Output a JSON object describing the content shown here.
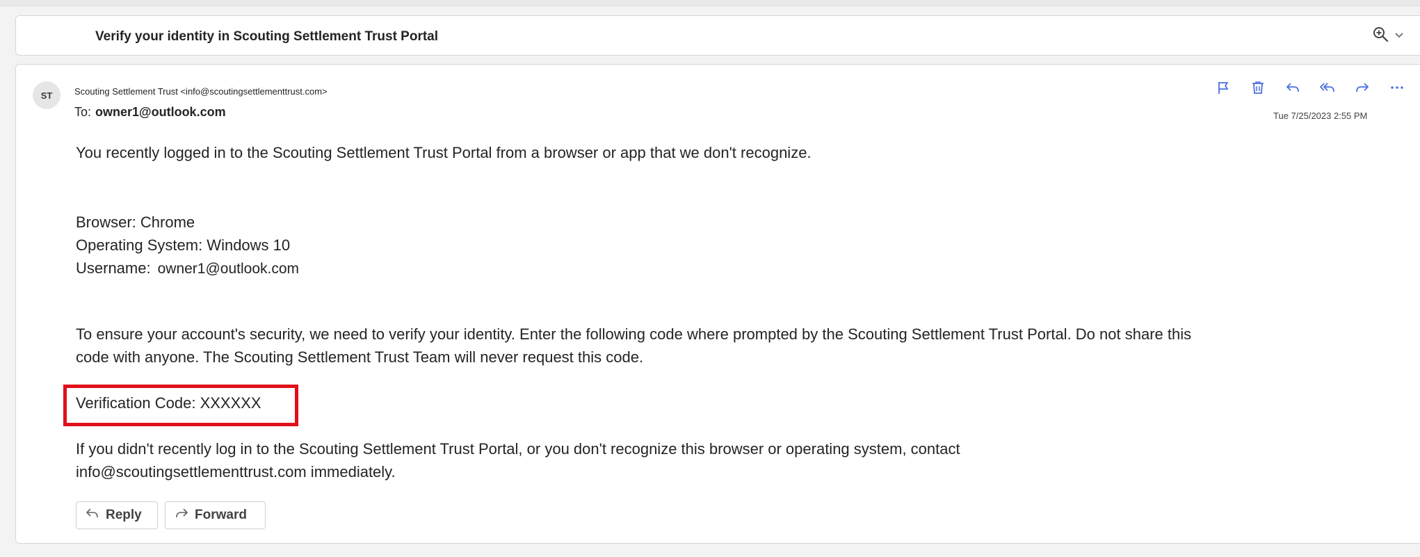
{
  "subject": {
    "title": "Verify your identity in Scouting Settlement Trust Portal",
    "zoom_icon": "zoom-in-icon",
    "dropdown_icon": "chevron-down-icon"
  },
  "message": {
    "avatar_initials": "ST",
    "from": "Scouting Settlement Trust <info@scoutingsettlementtrust.com>",
    "to_label": "To:",
    "to_address": "owner1@outlook.com",
    "timestamp": "Tue 7/25/2023 2:55 PM",
    "actions": [
      "flag-icon",
      "delete-icon",
      "reply-icon",
      "reply-all-icon",
      "forward-icon",
      "more-icon"
    ],
    "body": {
      "intro": "You recently logged in to the Scouting Settlement Trust Portal from a browser or app that we don't recognize.",
      "browser": "Browser: Chrome",
      "os": "Operating System: Windows 10",
      "username_label": "Username:",
      "username_value": "owner1@outlook.com",
      "security_line1": "To ensure your account's security, we need to verify your identity. Enter the following code where prompted by the Scouting Settlement Trust Portal. Do not share this",
      "security_line2": "code with anyone. The Scouting Settlement Trust Team will never request this code.",
      "code_label": "Verification Code:",
      "code_value": "XXXXXX",
      "last_line1": "If you didn't recently log in to the Scouting Settlement Trust Portal, or you don't recognize this browser or operating system, contact",
      "last_line2": "info@scoutingsettlementtrust.com immediately."
    },
    "buttons": {
      "reply": "Reply",
      "forward": "Forward"
    }
  },
  "colors": {
    "highlight_box": "#e0101b",
    "icon_blue": "#4a6ee0"
  }
}
